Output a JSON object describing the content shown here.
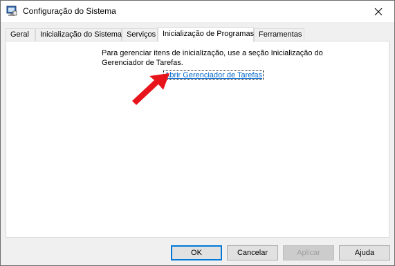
{
  "window": {
    "title": "Configuração do Sistema",
    "icon": "system-config-icon",
    "close_icon": "close-icon"
  },
  "tabs": [
    {
      "label": "Geral",
      "active": false
    },
    {
      "label": "Inicialização do Sistema",
      "active": false
    },
    {
      "label": "Serviços",
      "active": false
    },
    {
      "label": "Inicialização de Programas",
      "active": true
    },
    {
      "label": "Ferramentas",
      "active": false
    }
  ],
  "panel": {
    "message": "Para gerenciar itens de inicialização, use a seção Inicialização do Gerenciador de Tarefas.",
    "link_label": "Abrir Gerenciador de Tarefas",
    "annotation_arrow_color": "#e8141b"
  },
  "buttons": {
    "ok": "OK",
    "cancel": "Cancelar",
    "apply": "Aplicar",
    "help": "Ajuda"
  },
  "colors": {
    "link": "#0066cc",
    "accent": "#0078d7"
  }
}
